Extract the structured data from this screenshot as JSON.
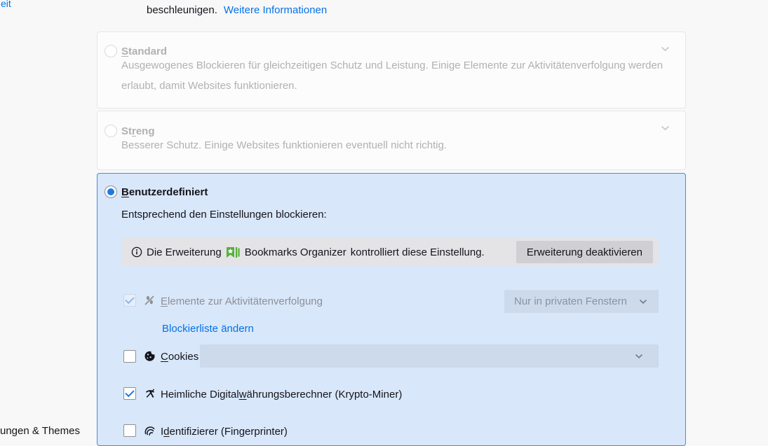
{
  "colors": {
    "accent_blue": "#1f7ae0",
    "selected_card_bg": "#d8e7fa",
    "selected_card_border": "#3f8ee3",
    "link_blue": "#0572e8",
    "extension_green": "#55b13c",
    "notice_bg": "#e4e4e7",
    "button_bg": "#d0d0d4",
    "disabled_text": "#b1b1b3"
  },
  "sidebar": {
    "top_partial_link": "eit",
    "bottom_partial_item": "ungen & Themes"
  },
  "intro": {
    "tail_text": "beschleunigen.",
    "link_label": "Weitere Informationen"
  },
  "protection_options": [
    {
      "label": "Standard",
      "accesskey": "S",
      "description": "Ausgewogenes Blockieren für gleichzeitigen Schutz und Leistung. Einige Elemente zur Aktivitätenverfolgung werden erlaubt, damit Websites funktionieren.",
      "selected": false,
      "disabled": true
    },
    {
      "label": "Streng",
      "accesskey": "r",
      "description": "Besserer Schutz. Einige Websites funktionieren eventuell nicht richtig.",
      "selected": false,
      "disabled": true
    },
    {
      "label": "Benutzerdefiniert",
      "accesskey": "B",
      "description": "Entsprechend den Einstellungen blockieren:",
      "selected": true,
      "disabled": false
    }
  ],
  "extension_notice": {
    "prefix": "Die Erweiterung",
    "extension_name": "Bookmarks Organizer",
    "suffix": "kontrolliert diese Einstellung.",
    "button_label": "Erweiterung deaktivieren"
  },
  "custom_rows": {
    "trackers": {
      "label": "Elemente zur Aktivitätenverfolgung",
      "accesskey": "E",
      "checked": true,
      "disabled": true,
      "dropdown_value": "Nur in privaten Fenstern"
    },
    "blocklist_link_label": "Blockierliste ändern",
    "cookies": {
      "label": "Cookies",
      "accesskey": "C",
      "checked": false,
      "dropdown_value": ""
    },
    "cryptominers": {
      "label": "Heimliche Digitalwährungsberechner (Krypto-Miner)",
      "accesskey": "w",
      "checked": true
    },
    "fingerprinters": {
      "label": "Identifizierer (Fingerprinter)",
      "accesskey": "d",
      "checked": false
    }
  }
}
